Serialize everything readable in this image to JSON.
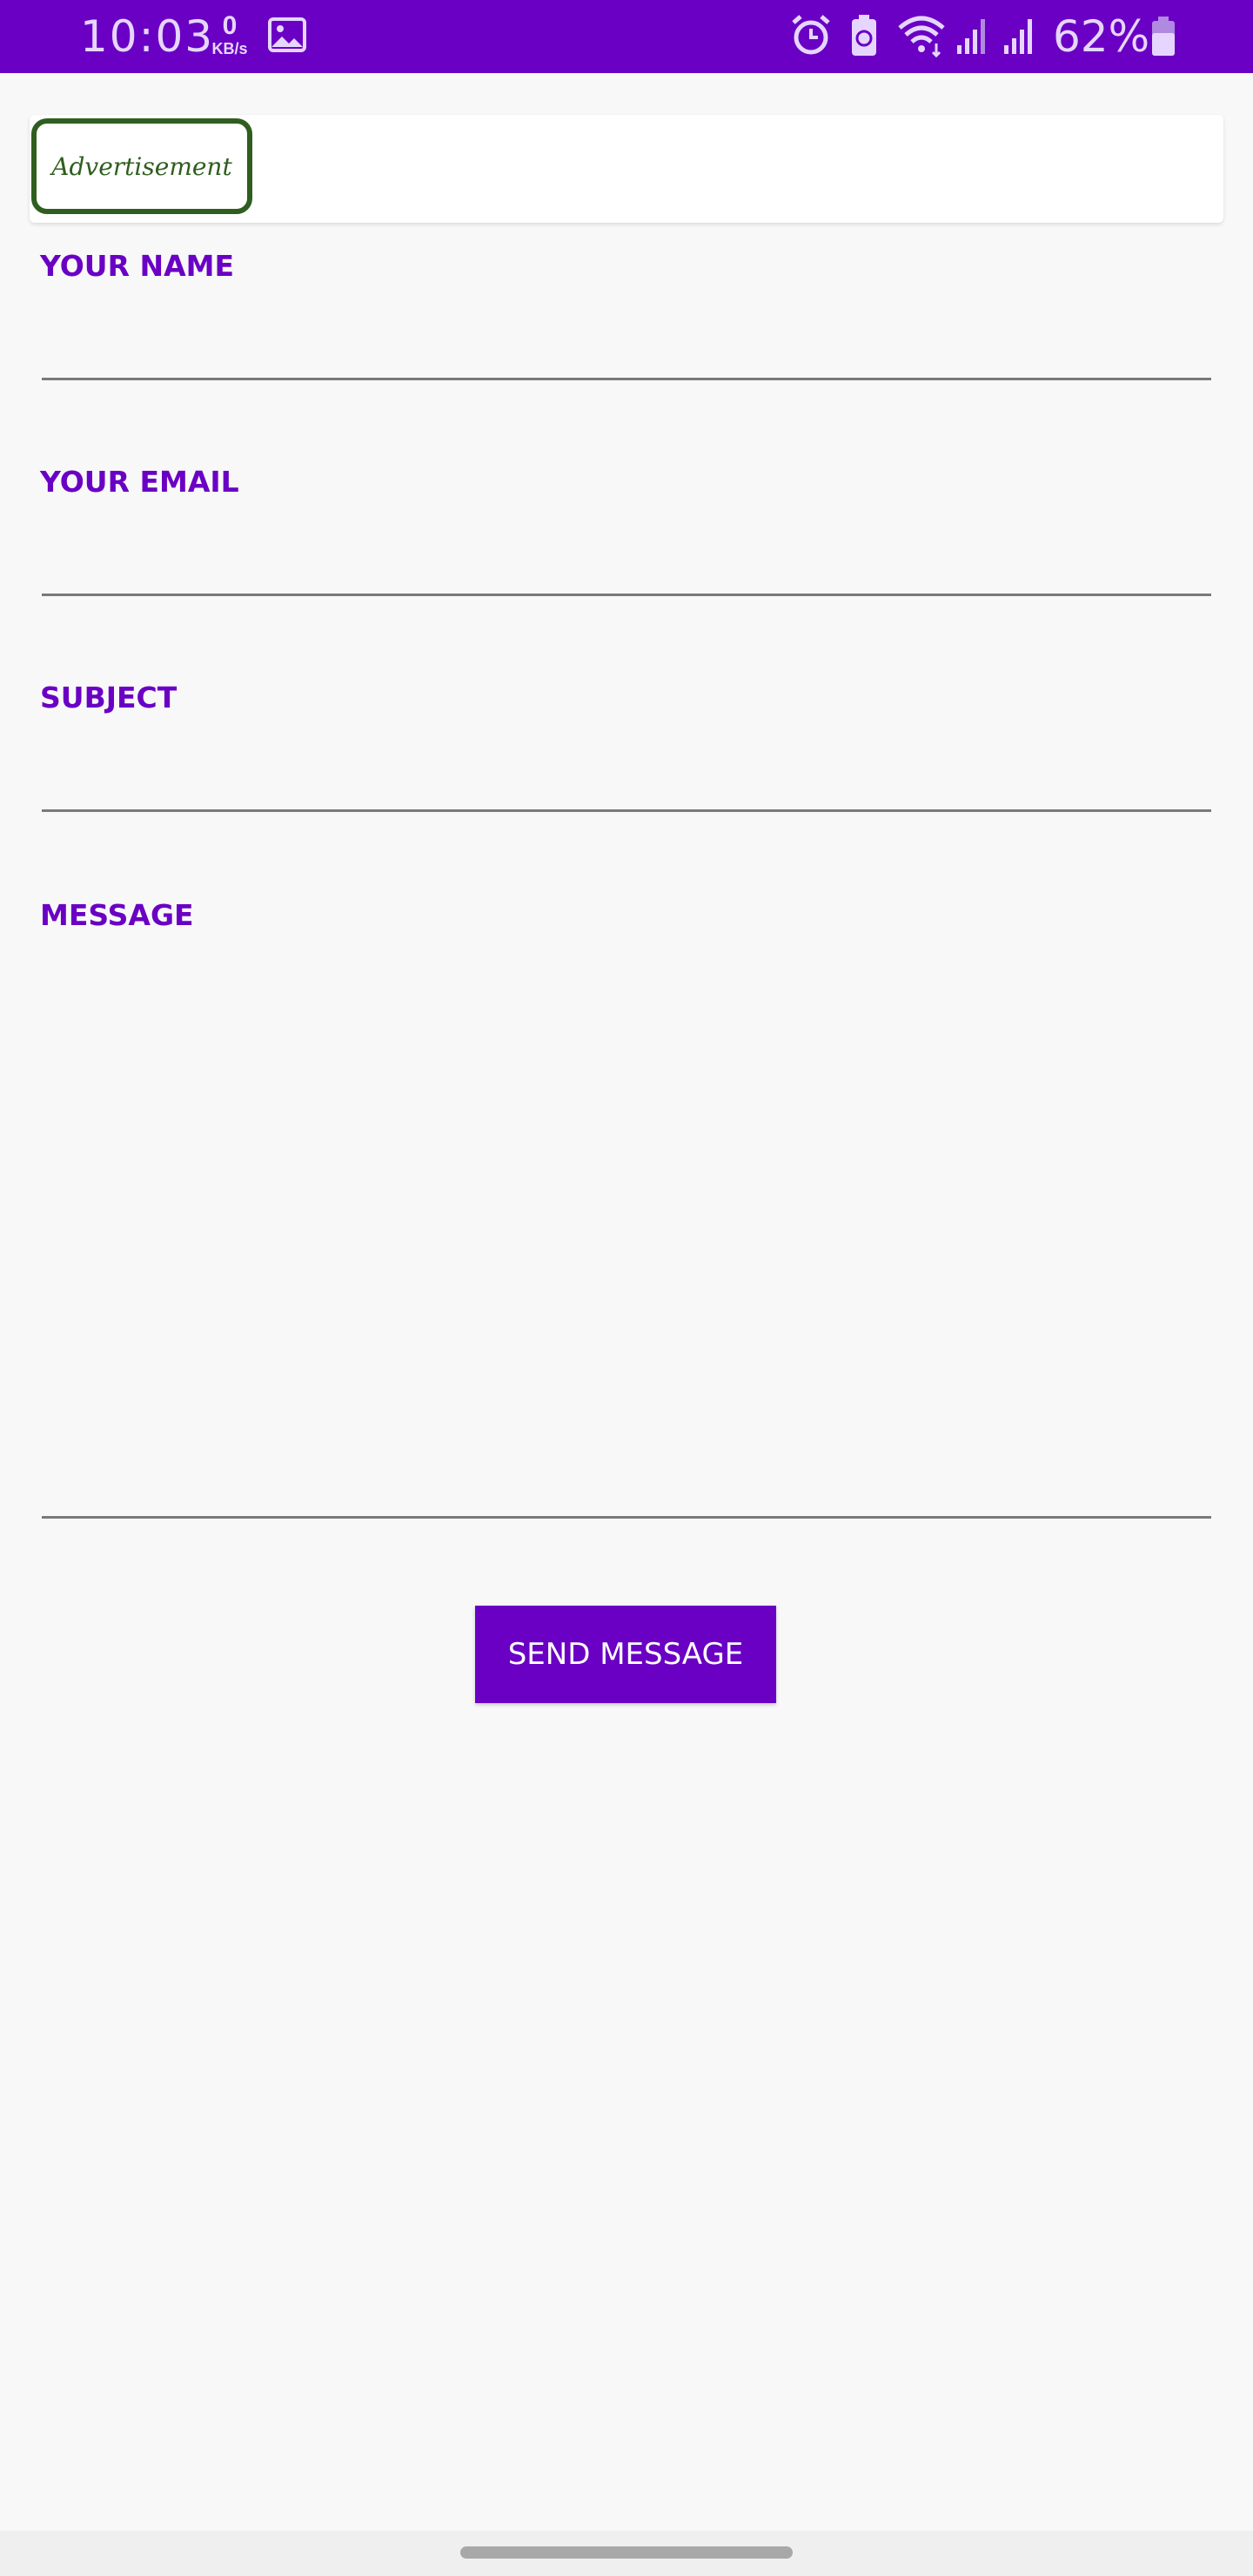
{
  "status_bar": {
    "time": "10:03",
    "net_speed_value": "0",
    "net_speed_unit": "KB/s",
    "battery_percent": "62%",
    "background_color": "#6a00c4",
    "icons": [
      "image-icon",
      "alarm-icon",
      "battery-saver-icon",
      "wifi-icon",
      "signal-icon",
      "signal-icon-2",
      "battery-icon"
    ]
  },
  "ad": {
    "label": "Advertisement",
    "border_color": "#2f5e1e"
  },
  "form": {
    "name_label": "YOUR NAME",
    "email_label": "YOUR EMAIL",
    "subject_label": "SUBJECT",
    "message_label": "MESSAGE",
    "name_value": "",
    "email_value": "",
    "subject_value": "",
    "message_value": "",
    "accent_color": "#6a00c4"
  },
  "send_button": {
    "label": "SEND MESSAGE"
  }
}
